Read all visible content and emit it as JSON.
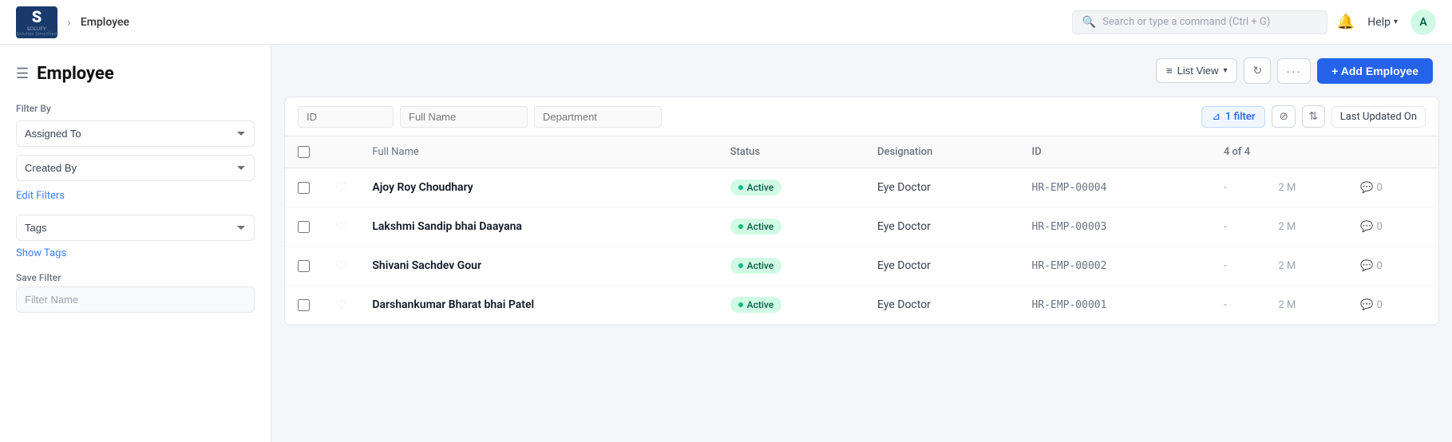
{
  "app": {
    "logo_letter": "S",
    "logo_subtext": "Solution Simplified",
    "breadcrumb_page": "Employee"
  },
  "topnav": {
    "search_placeholder": "Search or type a command (Ctrl + G)",
    "help_label": "Help",
    "avatar_letter": "A"
  },
  "sidebar": {
    "page_title": "Employee",
    "filter_by_label": "Filter By",
    "assigned_to_label": "Assigned To",
    "created_by_label": "Created By",
    "edit_filters_label": "Edit Filters",
    "tags_label": "Tags",
    "show_tags_label": "Show Tags",
    "save_filter_label": "Save Filter",
    "filter_name_placeholder": "Filter Name"
  },
  "toolbar": {
    "list_view_label": "List View",
    "add_employee_label": "+ Add Employee"
  },
  "filter_bar": {
    "id_placeholder": "ID",
    "full_name_placeholder": "Full Name",
    "department_placeholder": "Department",
    "filter_count_label": "1 filter",
    "sort_label": "Last Updated On"
  },
  "table": {
    "columns": {
      "full_name": "Full Name",
      "status": "Status",
      "designation": "Designation",
      "id": "ID",
      "count": "4 of 4"
    },
    "rows": [
      {
        "full_name": "Ajoy Roy Choudhary",
        "status": "Active",
        "designation": "Eye Doctor",
        "id": "HR-EMP-00004",
        "time": "2 M",
        "comments": "0"
      },
      {
        "full_name": "Lakshmi Sandip bhai Daayana",
        "status": "Active",
        "designation": "Eye Doctor",
        "id": "HR-EMP-00003",
        "time": "2 M",
        "comments": "0"
      },
      {
        "full_name": "Shivani Sachdev Gour",
        "status": "Active",
        "designation": "Eye Doctor",
        "id": "HR-EMP-00002",
        "time": "2 M",
        "comments": "0"
      },
      {
        "full_name": "Darshankumar Bharat bhai Patel",
        "status": "Active",
        "designation": "Eye Doctor",
        "id": "HR-EMP-00001",
        "time": "2 M",
        "comments": "0"
      }
    ]
  }
}
